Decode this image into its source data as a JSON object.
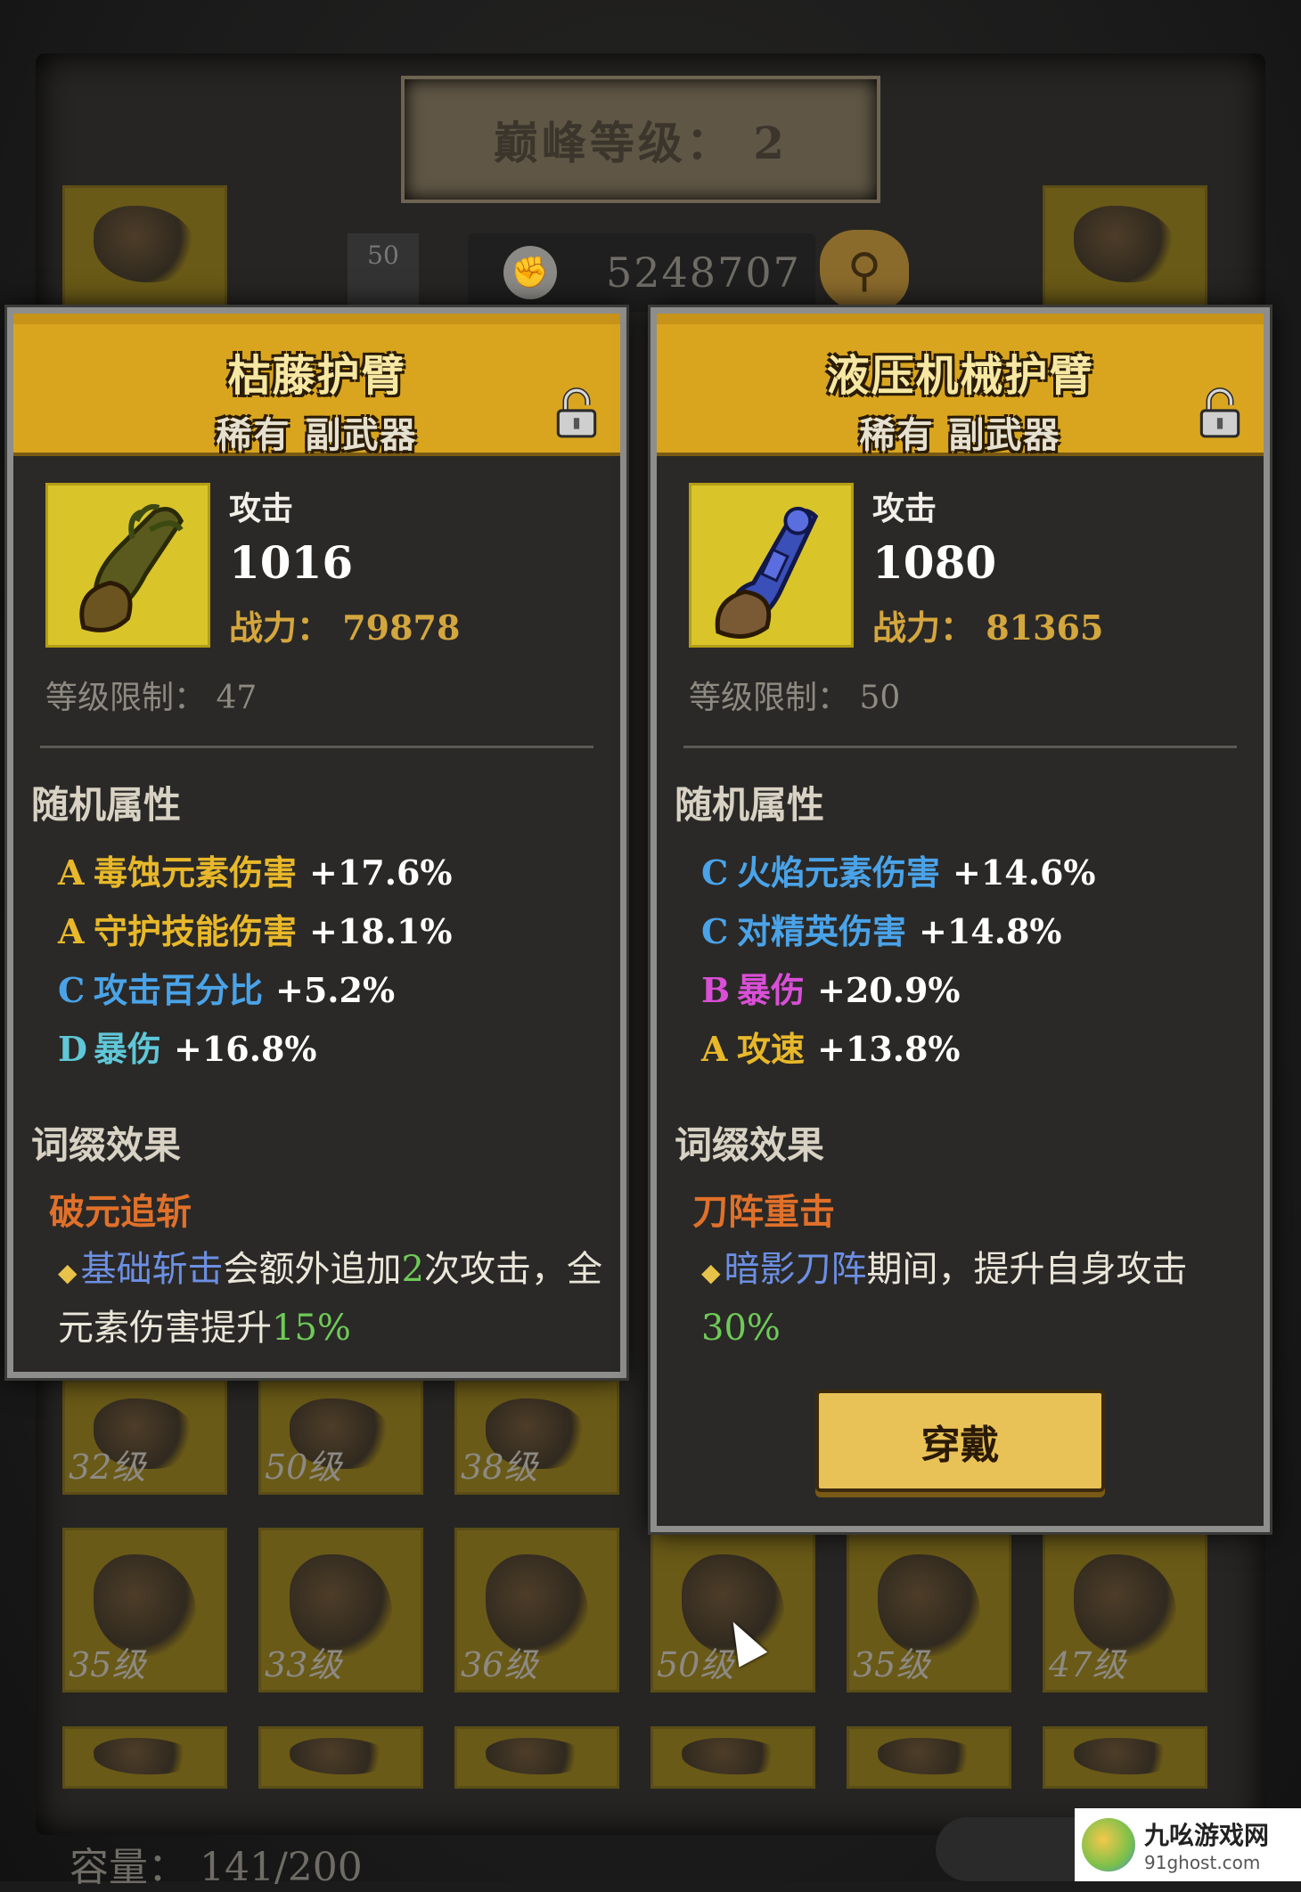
{
  "background": {
    "peak_level_label": "巅峰等级： 2",
    "level_chip": "50",
    "combat_power": "5248707",
    "capacity": "容量： 141/200",
    "slots": [
      {
        "level": ""
      },
      {
        "level": ""
      },
      {
        "level": "32级"
      },
      {
        "level": "50级"
      },
      {
        "level": "38级"
      },
      {
        "level": "35级"
      },
      {
        "level": "33级"
      },
      {
        "level": "36级"
      },
      {
        "level": "50级"
      },
      {
        "level": "35级"
      },
      {
        "level": "47级"
      }
    ]
  },
  "left_card": {
    "name": "枯藤护臂",
    "rarity_type": "稀有 副武器",
    "stat_label": "攻击",
    "stat_value": "1016",
    "power": "战力： 79878",
    "level_req": "等级限制： 47",
    "random_title": "随机属性",
    "attributes": [
      {
        "grade": "A",
        "name": "毒蚀元素伤害",
        "value": "+17.6%",
        "color": "#e8b82a"
      },
      {
        "grade": "A",
        "name": "守护技能伤害",
        "value": "+18.1%",
        "color": "#e8b82a"
      },
      {
        "grade": "C",
        "name": "攻击百分比",
        "value": "+5.2%",
        "color": "#4aa3e8"
      },
      {
        "grade": "D",
        "name": "暴伤",
        "value": "+16.8%",
        "color": "#5fc7d8"
      }
    ],
    "affix_title": "词缀效果",
    "affix_name": "破元追斩",
    "affix_desc": {
      "kw": "基础斩击",
      "t1": "会额外追加",
      "n1": "2",
      "t2": "次攻击，全元素伤害提升",
      "n2": "15%"
    }
  },
  "right_card": {
    "name": "液压机械护臂",
    "rarity_type": "稀有 副武器",
    "stat_label": "攻击",
    "stat_value": "1080",
    "power": "战力： 81365",
    "level_req": "等级限制： 50",
    "random_title": "随机属性",
    "attributes": [
      {
        "grade": "C",
        "name": "火焰元素伤害",
        "value": "+14.6%",
        "color": "#4aa3e8"
      },
      {
        "grade": "C",
        "name": "对精英伤害",
        "value": "+14.8%",
        "color": "#4aa3e8"
      },
      {
        "grade": "B",
        "name": "暴伤",
        "value": "+20.9%",
        "color": "#d94fd6"
      },
      {
        "grade": "A",
        "name": "攻速",
        "value": "+13.8%",
        "color": "#e8b82a"
      }
    ],
    "affix_title": "词缀效果",
    "affix_name": "刀阵重击",
    "affix_desc": {
      "kw": "暗影刀阵",
      "t1": "期间，提升自身攻击",
      "n1": "30%"
    },
    "equip_label": "穿戴"
  },
  "watermark": {
    "cn": "九吆游戏网",
    "en": "91ghost.com"
  }
}
